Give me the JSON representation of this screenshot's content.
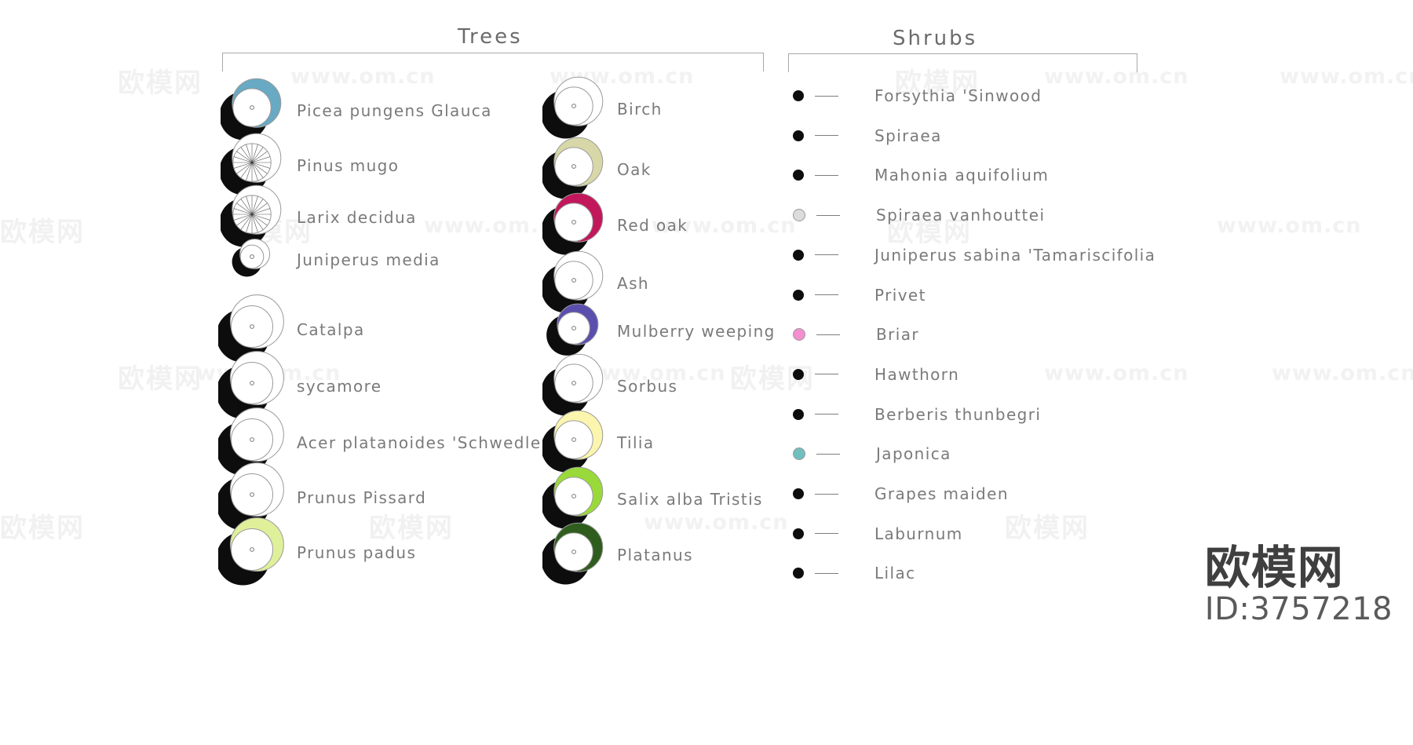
{
  "sections": [
    {
      "id": "trees",
      "title": "Trees"
    },
    {
      "id": "shrubs",
      "title": "Shrubs"
    }
  ],
  "trees_column_left": [
    {
      "label": "Picea pungens Glauca",
      "canopy_color": "#68a9c4",
      "size": 62,
      "style": "plain"
    },
    {
      "label": "Pinus mugo",
      "canopy_color": "#ffffff",
      "size": 62,
      "style": "spokes"
    },
    {
      "label": "Larix decidua",
      "canopy_color": "#ffffff",
      "size": 62,
      "style": "spokes"
    },
    {
      "label": "Juniperus media",
      "canopy_color": "#ffffff",
      "size": 38,
      "style": "plain"
    },
    {
      "label": "Catalpa",
      "canopy_color": "#ffffff",
      "size": 68,
      "style": "plain"
    },
    {
      "label": "sycamore",
      "canopy_color": "#ffffff",
      "size": 68,
      "style": "plain"
    },
    {
      "label": "Acer platanoides 'Schwedlen",
      "canopy_color": "#ffffff",
      "size": 68,
      "style": "plain"
    },
    {
      "label": "Prunus Pissard",
      "canopy_color": "#ffffff",
      "size": 68,
      "style": "plain"
    },
    {
      "label": "Prunus padus",
      "canopy_color": "#dff09a",
      "size": 68,
      "style": "plain"
    }
  ],
  "trees_column_right": [
    {
      "label": "Birch",
      "canopy_color": "#ffffff",
      "size": 62,
      "style": "plain"
    },
    {
      "label": "Oak",
      "canopy_color": "#d8d7a8",
      "size": 62,
      "style": "plain"
    },
    {
      "label": "Red oak",
      "canopy_color": "#c2175b",
      "size": 62,
      "style": "plain"
    },
    {
      "label": "Ash",
      "canopy_color": "#ffffff",
      "size": 62,
      "style": "plain"
    },
    {
      "label": "Mulberry weeping",
      "canopy_color": "#5b4fae",
      "size": 52,
      "style": "plain"
    },
    {
      "label": "Sorbus",
      "canopy_color": "#ffffff",
      "size": 62,
      "style": "plain"
    },
    {
      "label": "Tilia",
      "canopy_color": "#fbf5ae",
      "size": 62,
      "style": "plain"
    },
    {
      "label": "Salix alba Tristis",
      "canopy_color": "#9ad93a",
      "size": 62,
      "style": "plain"
    },
    {
      "label": "Platanus",
      "canopy_color": "#2f5d1e",
      "size": 62,
      "style": "plain"
    }
  ],
  "shrubs": [
    {
      "label": "Forsythia 'Sinwood",
      "dot_color": "#0d0d0d"
    },
    {
      "label": "Spiraea",
      "dot_color": "#0d0d0d"
    },
    {
      "label": "Mahonia aquifolium",
      "dot_color": "#0d0d0d"
    },
    {
      "label": "Spiraea vanhouttei",
      "dot_color": "#dcdcdc"
    },
    {
      "label": "Juniperus sabina 'Tamariscifolia",
      "dot_color": "#0d0d0d"
    },
    {
      "label": "Privet",
      "dot_color": "#0d0d0d"
    },
    {
      "label": "Briar",
      "dot_color": "#f48fd0"
    },
    {
      "label": "Hawthorn",
      "dot_color": "#0d0d0d"
    },
    {
      "label": "Berberis thunbegri",
      "dot_color": "#0d0d0d"
    },
    {
      "label": "Japonica",
      "dot_color": "#72bfbf"
    },
    {
      "label": "Grapes maiden",
      "dot_color": "#0d0d0d"
    },
    {
      "label": "Laburnum",
      "dot_color": "#0d0d0d"
    },
    {
      "label": "Lilac",
      "dot_color": "#0d0d0d"
    }
  ],
  "brand": {
    "name": "欧模网",
    "id": "ID:3757218"
  },
  "watermarks": {
    "cn": "欧模网",
    "url": "www.om.cn"
  },
  "colors": {
    "shadow": "#0d0d0d",
    "outline": "#9a9a9a",
    "text": "#7a7a7a",
    "bracket": "#a8a8a8"
  }
}
